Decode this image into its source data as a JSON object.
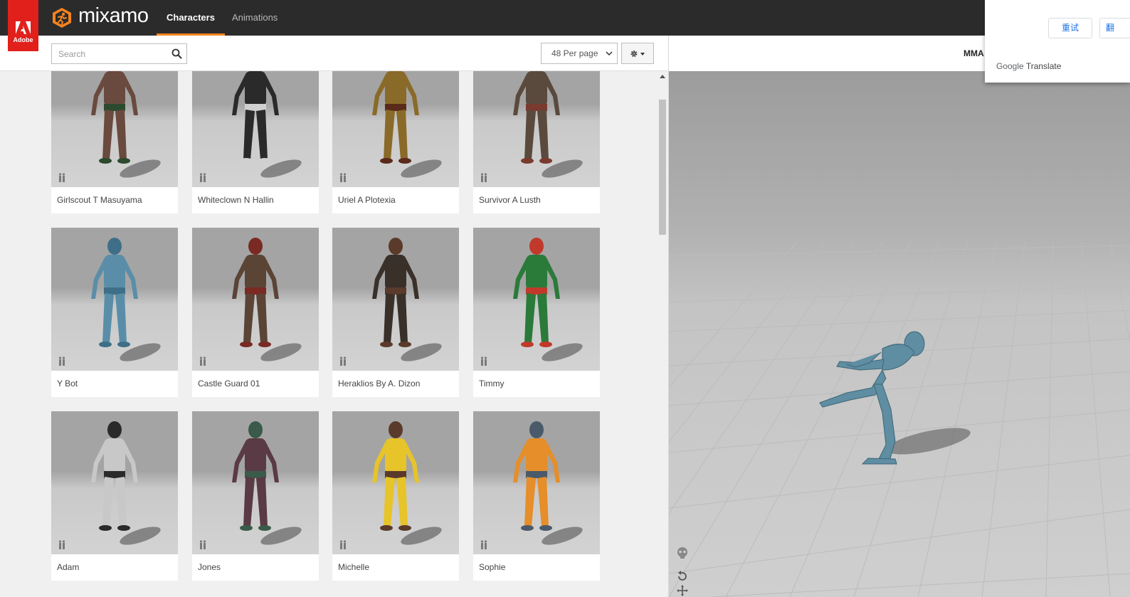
{
  "topbar": {
    "adobe_label": "Adobe",
    "logo_text": "mixamo",
    "tabs": [
      {
        "label": "Characters",
        "active": true
      },
      {
        "label": "Animations",
        "active": false
      }
    ]
  },
  "toolbar": {
    "search_placeholder": "Search",
    "per_page": "48 Per page"
  },
  "characters": [
    {
      "name": "Girlscout T Masuyama",
      "color": "#6a4a3e",
      "accent": "#2c4a2e"
    },
    {
      "name": "Whiteclown N Hallin",
      "color": "#2a2a2a",
      "accent": "#d0d0d0"
    },
    {
      "name": "Uriel A Plotexia",
      "color": "#8a6a28",
      "accent": "#5a2a1a"
    },
    {
      "name": "Survivor A Lusth",
      "color": "#5a4a3e",
      "accent": "#7a3a2e"
    },
    {
      "name": "Y Bot",
      "color": "#5a8ea8",
      "accent": "#3f6f88"
    },
    {
      "name": "Castle Guard 01",
      "color": "#5a4436",
      "accent": "#7a2a22"
    },
    {
      "name": "Heraklios By A. Dizon",
      "color": "#3a302a",
      "accent": "#5a3a2a"
    },
    {
      "name": "Timmy",
      "color": "#2a7a3a",
      "accent": "#c0392b"
    },
    {
      "name": "Adam",
      "color": "#c8c8c8",
      "accent": "#2a2a2a"
    },
    {
      "name": "Jones",
      "color": "#5a3a44",
      "accent": "#3a5a4a"
    },
    {
      "name": "Michelle",
      "color": "#e6c42a",
      "accent": "#5a3a2a"
    },
    {
      "name": "Sophie",
      "color": "#e58e2a",
      "accent": "#4a5a6a"
    }
  ],
  "viewport": {
    "title": "MMA",
    "figure_color": "#5f8da2"
  },
  "translate_popup": {
    "retry_label": "重试",
    "second_label": "翻",
    "google": "Google",
    "translate": "Translate"
  },
  "colors": {
    "accent": "#f4831f",
    "adobe_red": "#e1201c",
    "topbar": "#2b2b2b"
  }
}
